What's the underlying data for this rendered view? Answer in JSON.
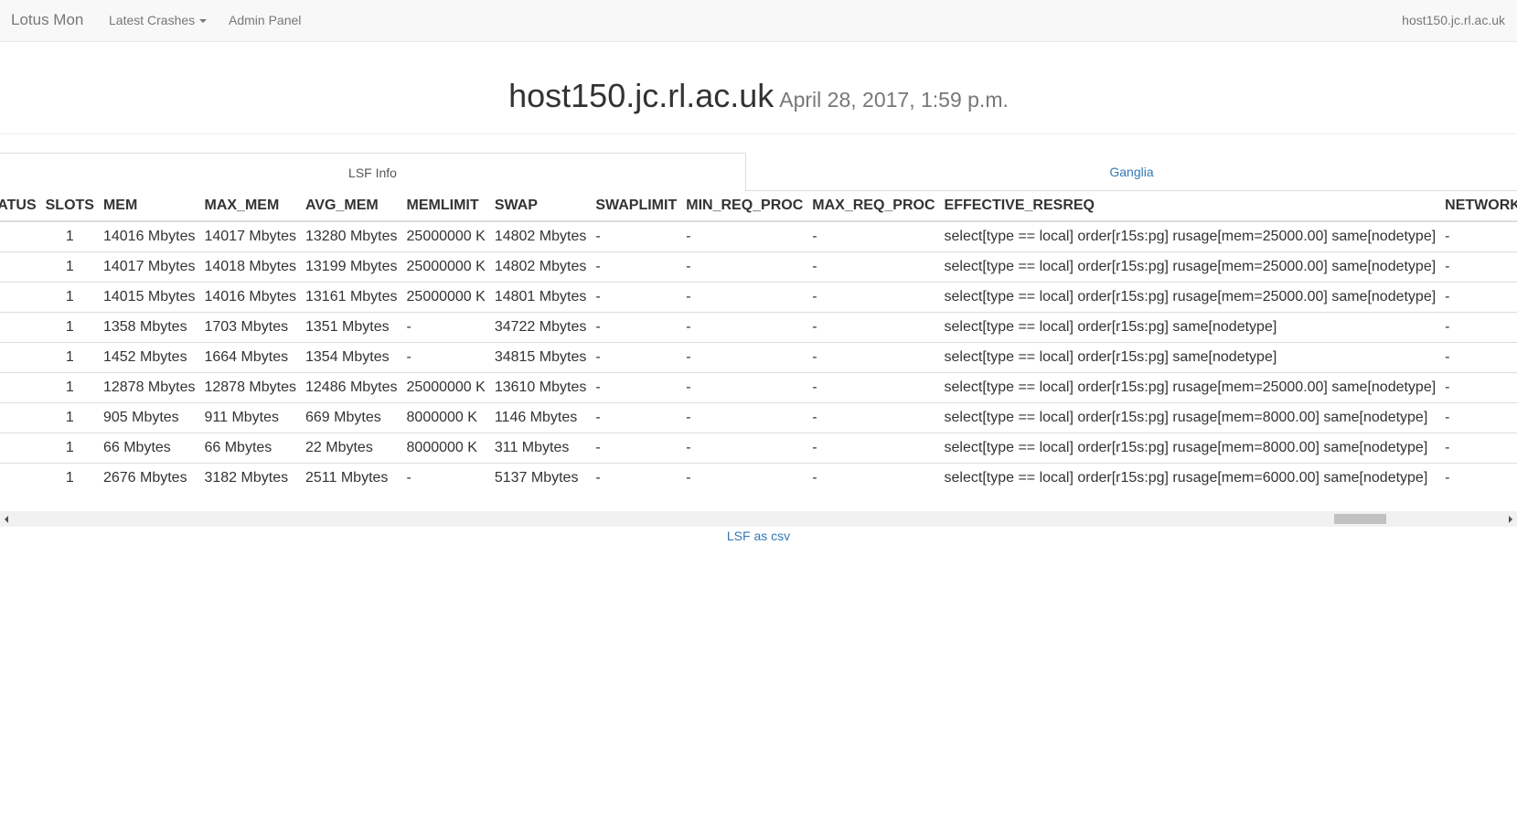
{
  "navbar": {
    "brand": "Lotus Mon",
    "links": [
      "Latest Crashes",
      "Admin Panel"
    ],
    "host": "host150.jc.rl.ac.uk"
  },
  "header": {
    "title": "host150.jc.rl.ac.uk",
    "date": "April 28, 2017, 1:59 p.m."
  },
  "tabs": [
    "LSF Info",
    "Ganglia"
  ],
  "table": {
    "columns": [
      "STATUS",
      "SLOTS",
      "MEM",
      "MAX_MEM",
      "AVG_MEM",
      "MEMLIMIT",
      "SWAP",
      "SWAPLIMIT",
      "MIN_REQ_PROC",
      "MAX_REQ_PROC",
      "EFFECTIVE_RESREQ",
      "NETWORK"
    ],
    "rows": [
      [
        "",
        "1",
        "14016 Mbytes",
        "14017 Mbytes",
        "13280 Mbytes",
        "25000000 K",
        "14802 Mbytes",
        "-",
        "-",
        "-",
        "select[type == local] order[r15s:pg] rusage[mem=25000.00] same[nodetype]",
        "-"
      ],
      [
        "",
        "1",
        "14017 Mbytes",
        "14018 Mbytes",
        "13199 Mbytes",
        "25000000 K",
        "14802 Mbytes",
        "-",
        "-",
        "-",
        "select[type == local] order[r15s:pg] rusage[mem=25000.00] same[nodetype]",
        "-"
      ],
      [
        "",
        "1",
        "14015 Mbytes",
        "14016 Mbytes",
        "13161 Mbytes",
        "25000000 K",
        "14801 Mbytes",
        "-",
        "-",
        "-",
        "select[type == local] order[r15s:pg] rusage[mem=25000.00] same[nodetype]",
        "-"
      ],
      [
        "",
        "1",
        "1358 Mbytes",
        "1703 Mbytes",
        "1351 Mbytes",
        "-",
        "34722 Mbytes",
        "-",
        "-",
        "-",
        "select[type == local] order[r15s:pg] same[nodetype]",
        "-"
      ],
      [
        "",
        "1",
        "1452 Mbytes",
        "1664 Mbytes",
        "1354 Mbytes",
        "-",
        "34815 Mbytes",
        "-",
        "-",
        "-",
        "select[type == local] order[r15s:pg] same[nodetype]",
        "-"
      ],
      [
        "",
        "1",
        "12878 Mbytes",
        "12878 Mbytes",
        "12486 Mbytes",
        "25000000 K",
        "13610 Mbytes",
        "-",
        "-",
        "-",
        "select[type == local] order[r15s:pg] rusage[mem=25000.00] same[nodetype]",
        "-"
      ],
      [
        "",
        "1",
        "905 Mbytes",
        "911 Mbytes",
        "669 Mbytes",
        "8000000 K",
        "1146 Mbytes",
        "-",
        "-",
        "-",
        "select[type == local] order[r15s:pg] rusage[mem=8000.00] same[nodetype]",
        "-"
      ],
      [
        "",
        "1",
        "66 Mbytes",
        "66 Mbytes",
        "22 Mbytes",
        "8000000 K",
        "311 Mbytes",
        "-",
        "-",
        "-",
        "select[type == local] order[r15s:pg] rusage[mem=8000.00] same[nodetype]",
        "-"
      ],
      [
        "",
        "1",
        "2676 Mbytes",
        "3182 Mbytes",
        "2511 Mbytes",
        "-",
        "5137 Mbytes",
        "-",
        "-",
        "-",
        "select[type == local] order[r15s:pg] rusage[mem=6000.00] same[nodetype]",
        "-"
      ]
    ]
  },
  "csv_link": "LSF as csv",
  "colors": {
    "navbar_bg": "#f8f8f8",
    "link": "#337ab7",
    "muted": "#777777",
    "border": "#dddddd"
  }
}
